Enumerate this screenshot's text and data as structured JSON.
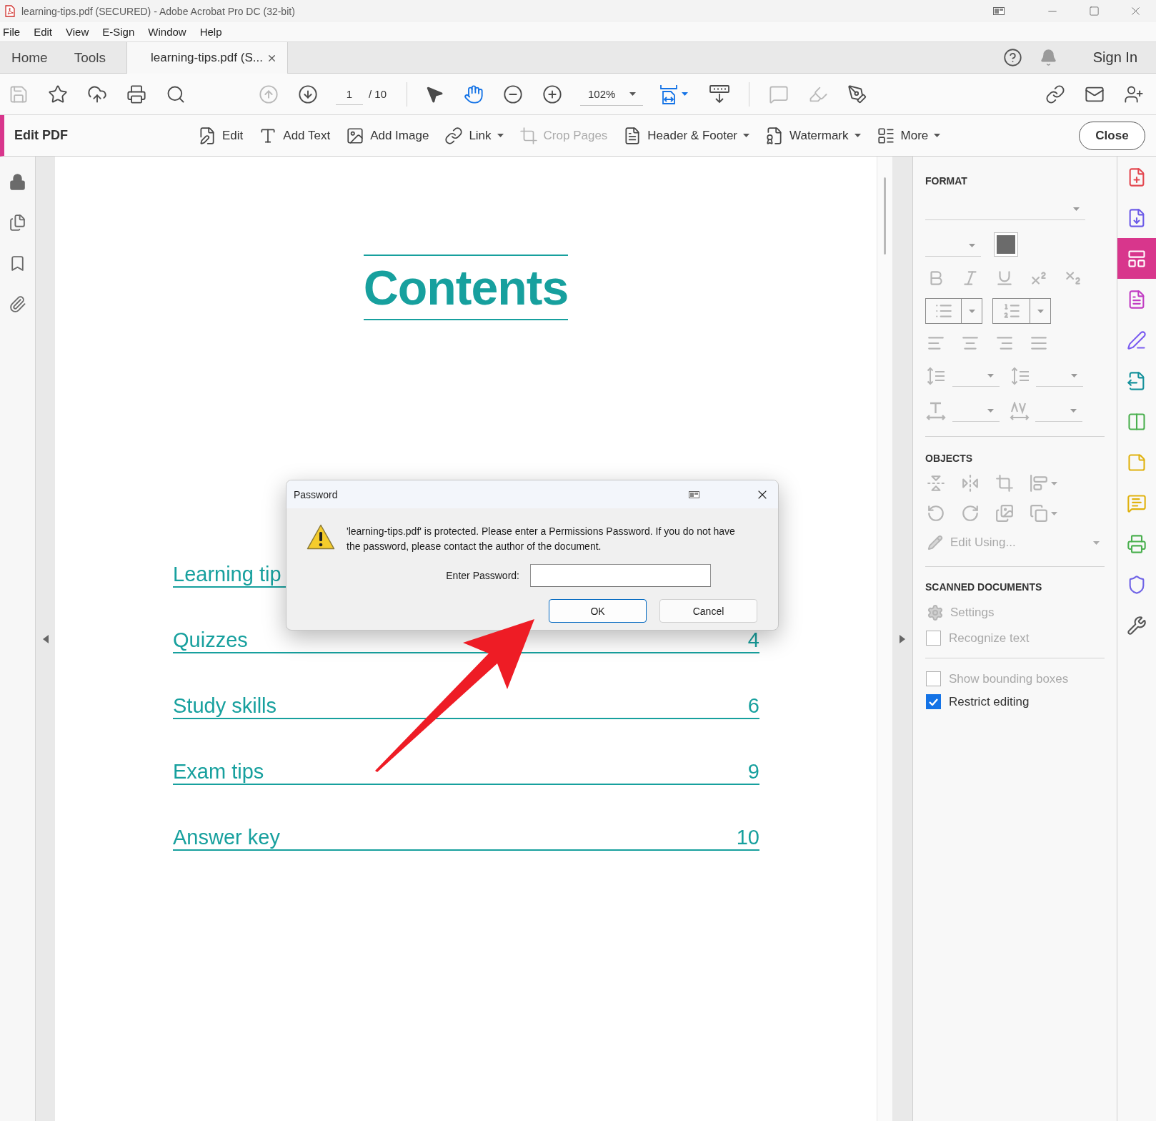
{
  "window": {
    "title": "learning-tips.pdf (SECURED) - Adobe Acrobat Pro DC (32-bit)"
  },
  "menu": [
    "File",
    "Edit",
    "View",
    "E-Sign",
    "Window",
    "Help"
  ],
  "tabs": [
    {
      "label": "Home",
      "selected": false
    },
    {
      "label": "Tools",
      "selected": false
    },
    {
      "label": "learning-tips.pdf (S...",
      "selected": true
    }
  ],
  "account": {
    "sign_in": "Sign In"
  },
  "toolbar": {
    "items": [
      {
        "kind": "save",
        "disabled": true
      },
      {
        "kind": "star",
        "disabled": false
      },
      {
        "kind": "upload",
        "disabled": false
      },
      {
        "kind": "print",
        "disabled": false
      },
      {
        "kind": "find",
        "disabled": false
      }
    ],
    "navigation": [
      {
        "kind": "page-up",
        "disabled": true
      },
      {
        "kind": "page-down",
        "disabled": false
      }
    ],
    "page_current": "1",
    "page_total": "/ 10",
    "tools": [
      {
        "kind": "select",
        "selected": false
      },
      {
        "kind": "hand",
        "selected": true
      }
    ],
    "zoom_buttons": [
      {
        "kind": "zoom-out"
      },
      {
        "kind": "zoom-in"
      }
    ],
    "zoom": "102%",
    "view": [
      {
        "kind": "fit-page",
        "selected": true,
        "dropdown": true
      },
      {
        "kind": "scroll-mode",
        "selected": false,
        "dropdown": false
      }
    ],
    "review": [
      {
        "kind": "comment",
        "disabled": true
      },
      {
        "kind": "highlight",
        "disabled": true
      },
      {
        "kind": "sign",
        "disabled": false
      }
    ],
    "share": [
      {
        "kind": "share-link"
      },
      {
        "kind": "email"
      },
      {
        "kind": "add-user"
      }
    ]
  },
  "edit_bar": {
    "title": "Edit PDF",
    "tools": [
      {
        "kind": "edit",
        "label": "Edit",
        "dropdown": false,
        "disabled": false
      },
      {
        "kind": "add-text",
        "label": "Add Text",
        "dropdown": false,
        "disabled": false
      },
      {
        "kind": "add-image",
        "label": "Add Image",
        "dropdown": false,
        "disabled": false
      },
      {
        "kind": "link",
        "label": "Link",
        "dropdown": true,
        "disabled": false
      },
      {
        "kind": "crop",
        "label": "Crop Pages",
        "dropdown": false,
        "disabled": true
      },
      {
        "kind": "header-footer",
        "label": "Header & Footer",
        "dropdown": true,
        "disabled": false
      },
      {
        "kind": "watermark",
        "label": "Watermark",
        "dropdown": true,
        "disabled": false
      },
      {
        "kind": "more",
        "label": "More",
        "dropdown": true,
        "disabled": false
      }
    ],
    "close": "Close"
  },
  "left_rail": [
    {
      "kind": "lock"
    },
    {
      "kind": "pages"
    },
    {
      "kind": "bookmarks"
    },
    {
      "kind": "attachments"
    }
  ],
  "document": {
    "title": "Contents",
    "entries": [
      {
        "title": "Learning tip"
      },
      {
        "title": "Quizzes",
        "page": "4"
      },
      {
        "title": "Study skills",
        "page": "6"
      },
      {
        "title": "Exam tips",
        "page": "9"
      },
      {
        "title": "Answer key",
        "page": "10"
      }
    ]
  },
  "dialog": {
    "title": "Password",
    "message": "'learning-tips.pdf' is protected. Please enter a Permissions Password. If you do not have the password, please contact the author of the document.",
    "field_label": "Enter Password:",
    "buttons": [
      {
        "label": "OK",
        "default": true
      },
      {
        "label": "Cancel",
        "default": false
      }
    ]
  },
  "panel": {
    "format_heading": "FORMAT",
    "objects_heading": "OBJECTS",
    "edit_using": {
      "label": "Edit Using...",
      "disabled": true
    },
    "scanned_heading": "SCANNED DOCUMENTS",
    "settings": {
      "label": "Settings",
      "disabled": true
    },
    "checkboxes": [
      {
        "label": "Recognize text",
        "checked": false,
        "disabled": true
      },
      {
        "label": "Show bounding boxes",
        "checked": false,
        "disabled": true
      },
      {
        "label": "Restrict editing",
        "checked": true,
        "disabled": false
      }
    ]
  },
  "tool_rail": [
    {
      "kind": "create-pdf",
      "selected": false
    },
    {
      "kind": "export-pdf",
      "selected": false
    },
    {
      "kind": "edit-pdf",
      "selected": true
    },
    {
      "kind": "prepare-form",
      "selected": false
    },
    {
      "kind": "fill-sign",
      "selected": false
    },
    {
      "kind": "send",
      "selected": false
    },
    {
      "kind": "organize",
      "selected": false
    },
    {
      "kind": "comment-doc",
      "selected": false
    },
    {
      "kind": "comment",
      "selected": false
    },
    {
      "kind": "print-production",
      "selected": false
    },
    {
      "kind": "protect",
      "selected": false
    },
    {
      "kind": "more-tools",
      "selected": false
    }
  ]
}
